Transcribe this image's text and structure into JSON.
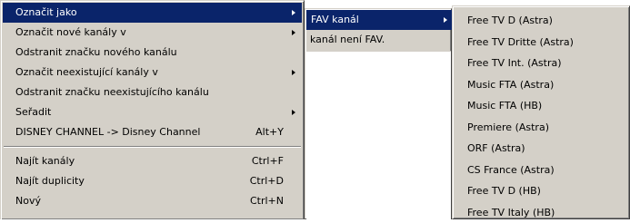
{
  "main_menu": {
    "items": [
      {
        "label": "Označit jako",
        "shortcut": "",
        "submenu": true,
        "selected": true
      },
      {
        "label": "Označit nové kanály v",
        "shortcut": "",
        "submenu": true
      },
      {
        "label": "Odstranit značku nového kanálu",
        "shortcut": "",
        "submenu": false
      },
      {
        "label": "Označit neexistující kanály v",
        "shortcut": "",
        "submenu": true
      },
      {
        "label": "Odstranit značku neexistujícího kanálu",
        "shortcut": "",
        "submenu": false
      },
      {
        "label": "Seřadit",
        "shortcut": "",
        "submenu": true
      },
      {
        "label": "DISNEY CHANNEL -> Disney Channel",
        "shortcut": "Alt+Y",
        "submenu": false
      },
      {
        "label": "Najít kanály",
        "shortcut": "Ctrl+F",
        "submenu": false
      },
      {
        "label": "Najít duplicity",
        "shortcut": "Ctrl+D",
        "submenu": false
      },
      {
        "label": "Nový",
        "shortcut": "Ctrl+N",
        "submenu": false
      }
    ]
  },
  "submenu_mark": {
    "items": [
      {
        "label": "FAV kanál",
        "submenu": true,
        "selected": true
      },
      {
        "label": "kanál není FAV."
      }
    ]
  },
  "submenu_fav": {
    "items": [
      {
        "label": "Free TV D (Astra)"
      },
      {
        "label": "Free TV Dritte (Astra)"
      },
      {
        "label": "Free TV Int. (Astra)"
      },
      {
        "label": "Music FTA (Astra)"
      },
      {
        "label": "Music FTA (HB)"
      },
      {
        "label": "Premiere (Astra)"
      },
      {
        "label": "ORF (Astra)"
      },
      {
        "label": "CS France (Astra)"
      },
      {
        "label": "Free TV D (HB)"
      },
      {
        "label": "Free TV Italy (HB)"
      }
    ]
  },
  "colors": {
    "menu_bg": "#d4d0c8",
    "highlight": "#0a246a",
    "highlight_text": "#ffffff"
  }
}
